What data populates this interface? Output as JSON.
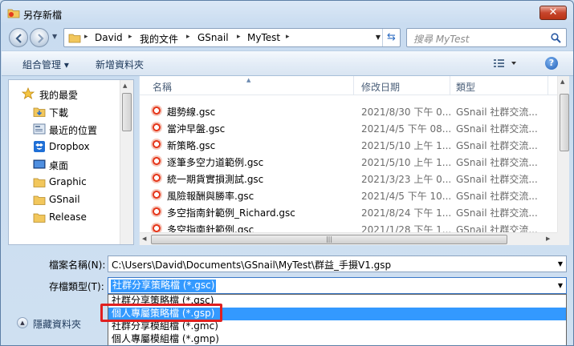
{
  "window": {
    "title": "另存新檔",
    "close_glyph": "✕"
  },
  "address": {
    "crumbs": [
      "David",
      "我的文件",
      "GSnail",
      "MyTest"
    ],
    "separator": "▸"
  },
  "search": {
    "placeholder": "搜尋 MyTest"
  },
  "toolbar": {
    "organize": "組合管理 ▾",
    "new_folder": "新增資料夾",
    "help": "?"
  },
  "nav": {
    "items": [
      {
        "label": "我的最愛",
        "icon": "star-icon"
      },
      {
        "label": "下載",
        "icon": "download-folder-icon"
      },
      {
        "label": "最近的位置",
        "icon": "recent-places-icon"
      },
      {
        "label": "Dropbox",
        "icon": "dropbox-icon"
      },
      {
        "label": "桌面",
        "icon": "desktop-icon"
      },
      {
        "label": "Graphic",
        "icon": "folder-icon"
      },
      {
        "label": "GSnail",
        "icon": "folder-icon"
      },
      {
        "label": "Release",
        "icon": "folder-icon"
      }
    ]
  },
  "columns": {
    "name": "名稱",
    "date": "修改日期",
    "type": "類型"
  },
  "files": [
    {
      "name": "趨勢線.gsc",
      "date": "2021/8/30 下午 0...",
      "type": "GSnail 社群交流..."
    },
    {
      "name": "當沖早盤.gsc",
      "date": "2021/4/5 下午 08...",
      "type": "GSnail 社群交流..."
    },
    {
      "name": "新策略.gsc",
      "date": "2021/5/10 上午 1...",
      "type": "GSnail 社群交流..."
    },
    {
      "name": "逐筆多空力道範例.gsc",
      "date": "2021/5/10 上午 1...",
      "type": "GSnail 社群交流..."
    },
    {
      "name": "統一期貨實損測試.gsc",
      "date": "2021/3/23 上午 0...",
      "type": "GSnail 社群交流..."
    },
    {
      "name": "風險報酬與勝率.gsc",
      "date": "2021/4/5 下午 10...",
      "type": "GSnail 社群交流..."
    },
    {
      "name": "多空指南針範例_Richard.gsc",
      "date": "2021/8/24 下午 1...",
      "type": "GSnail 社群交流..."
    },
    {
      "name": "多空指南針範例.gsc",
      "date": "2021/1/28 下午 1...",
      "type": "GSnail 社群交流..."
    }
  ],
  "form": {
    "filename_label": "檔案名稱(N):",
    "filename_value": "C:\\Users\\David\\Documents\\GSnail\\MyTest\\群益_手摄V1.gsp",
    "filetype_label": "存檔類型(T):",
    "filetype_value": "社群分享策略檔 (*.gsc)",
    "options": [
      "社群分享策略檔 (*.gsc)",
      "個人專屬策略檔 (*.gsp)",
      "社群分享模組檔 (*.gmc)",
      "個人專屬模組檔 (*.gmp)"
    ],
    "highlighted_option": 1
  },
  "footer": {
    "hide_folders": "隱藏資料夾"
  },
  "colors": {
    "highlight": "#3399ff",
    "annotation": "#e02020"
  }
}
